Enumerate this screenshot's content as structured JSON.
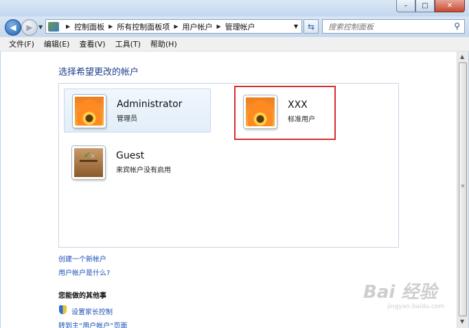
{
  "window": {
    "minimize_glyph": "–",
    "maximize_glyph": "□",
    "close_glyph": "✕"
  },
  "nav": {
    "breadcrumbs": [
      "控制面板",
      "所有控制面板项",
      "用户帐户",
      "管理帐户"
    ],
    "search_placeholder": "搜索控制面板"
  },
  "menu": [
    "文件(F)",
    "编辑(E)",
    "查看(V)",
    "工具(T)",
    "帮助(H)"
  ],
  "main": {
    "heading": "选择希望更改的帐户",
    "accounts": [
      {
        "name": "Administrator",
        "type": "管理员",
        "picture": "flower-icon"
      },
      {
        "name": "XXX",
        "type": "标准用户",
        "picture": "flower-icon"
      },
      {
        "name": "Guest",
        "type": "来宾帐户没有启用",
        "picture": "briefcase-icon"
      }
    ],
    "links": [
      "创建一个新帐户",
      "用户帐户是什么?"
    ],
    "other_heading": "您能做的其他事",
    "other_items": [
      "设置家长控制",
      "转到主“用户帐户”页面"
    ]
  },
  "watermark": {
    "main": "Bai 经验",
    "sub": "jingyan.baidu.com"
  },
  "colors": {
    "link": "#1a4fb8",
    "heading": "#1f3f8a",
    "highlight_border": "#d92c2c"
  }
}
